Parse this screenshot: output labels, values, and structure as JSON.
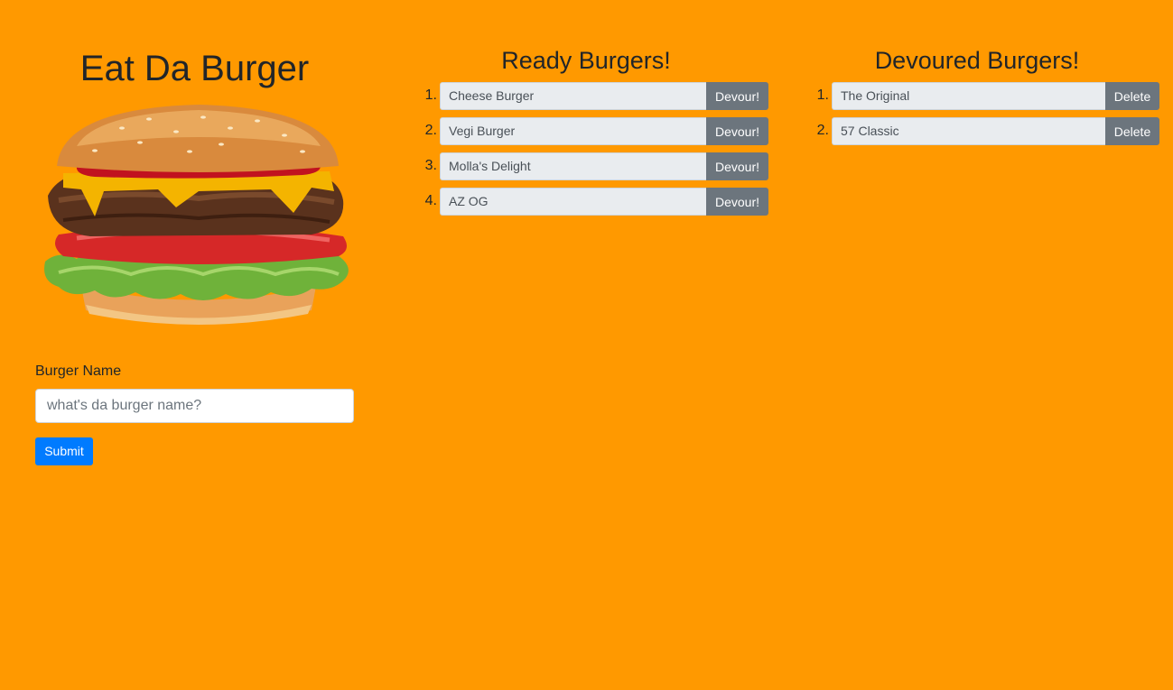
{
  "app": {
    "title": "Eat Da Burger",
    "background_color": "#ff9900"
  },
  "form": {
    "label": "Burger Name",
    "placeholder": "what's da burger name?",
    "submit_label": "Submit",
    "submit_color": "#007bff"
  },
  "ready": {
    "title": "Ready Burgers!",
    "action_label": "Devour!",
    "items": [
      {
        "number": "1.",
        "name": "Cheese Burger"
      },
      {
        "number": "2.",
        "name": "Vegi Burger"
      },
      {
        "number": "3.",
        "name": "Molla's Delight"
      },
      {
        "number": "4.",
        "name": "AZ OG"
      }
    ]
  },
  "devoured": {
    "title": "Devoured Burgers!",
    "action_label": "Delete",
    "items": [
      {
        "number": "1.",
        "name": "The Original"
      },
      {
        "number": "2.",
        "name": "57 Classic"
      }
    ]
  },
  "icons": {
    "hero_image": "burger-illustration"
  }
}
